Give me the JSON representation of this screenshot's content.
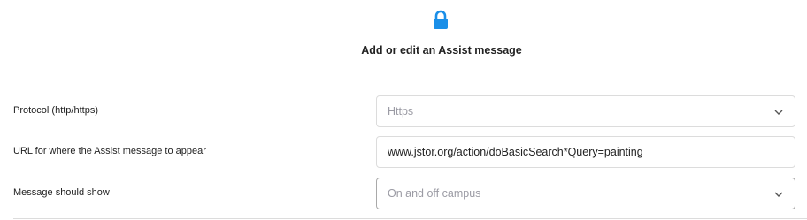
{
  "dialog": {
    "title": "Add or edit an Assist message",
    "icon": "lock-icon",
    "accent_color": "#1a8fe8"
  },
  "fields": {
    "protocol": {
      "label": "Protocol (http/https)",
      "value": "Https",
      "icon": "chevron-down-icon"
    },
    "url": {
      "label": "URL for where the Assist message to appear",
      "value": "www.jstor.org/action/doBasicSearch*Query=painting"
    },
    "display": {
      "label": "Message should show",
      "value": "On and off campus",
      "icon": "chevron-down-icon"
    }
  }
}
